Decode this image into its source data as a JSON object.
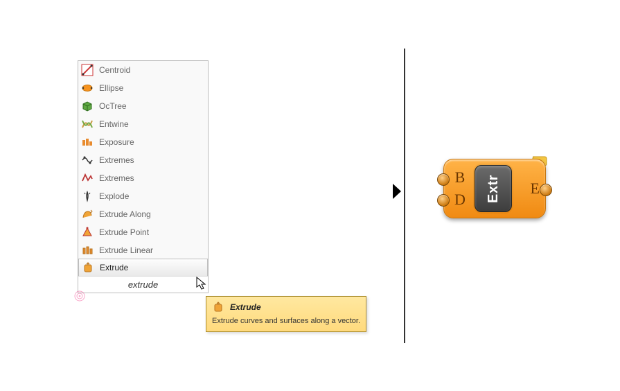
{
  "menu": {
    "items": [
      {
        "label": "Centroid"
      },
      {
        "label": "Ellipse"
      },
      {
        "label": "OcTree"
      },
      {
        "label": "Entwine"
      },
      {
        "label": "Exposure"
      },
      {
        "label": "Extremes"
      },
      {
        "label": "Extremes"
      },
      {
        "label": "Explode"
      },
      {
        "label": "Extrude Along"
      },
      {
        "label": "Extrude Point"
      },
      {
        "label": "Extrude Linear"
      },
      {
        "label": "Extrude"
      }
    ],
    "search_value": "extrude"
  },
  "tooltip": {
    "title": "Extrude",
    "desc": "Extrude curves and surfaces along a vector."
  },
  "component": {
    "name": "Extr",
    "inputs": [
      "B",
      "D"
    ],
    "outputs": [
      "E"
    ]
  }
}
